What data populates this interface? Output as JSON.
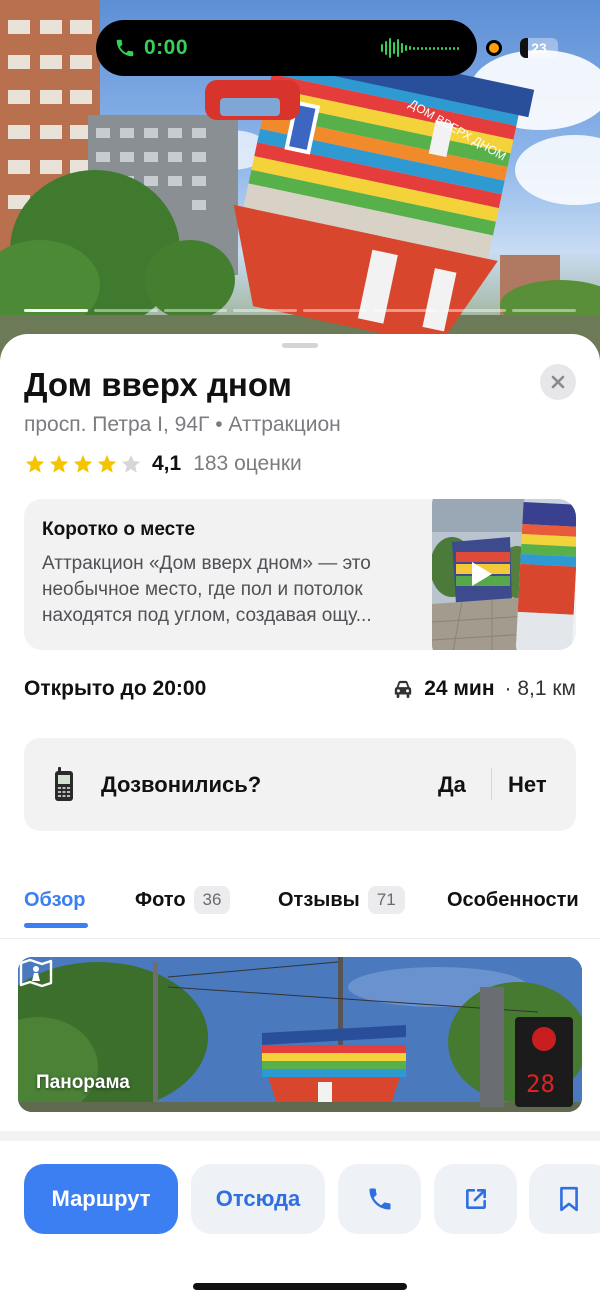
{
  "status": {
    "call_timer": "0:00",
    "battery": "23"
  },
  "place": {
    "title": "Дом вверх дном",
    "subtitle": "просп. Петра I, 94Г • Аттракцион",
    "rating_value": "4,1",
    "rating_stars": 4,
    "reviews_count_text": "183 оценки"
  },
  "about": {
    "heading": "Коротко о месте",
    "text": "Аттракцион «Дом вверх дном» — это необычное место, где пол и потолок находятся под углом, создавая ощу..."
  },
  "hours": {
    "open_text": "Открыто до 20:00",
    "travel_time": "24 мин",
    "distance": "· 8,1 км"
  },
  "call_prompt": {
    "question": "Дозвонились?",
    "yes": "Да",
    "no": "Нет"
  },
  "tabs": [
    {
      "label": "Обзор",
      "count": ""
    },
    {
      "label": "Фото",
      "count": "36"
    },
    {
      "label": "Отзывы",
      "count": "71"
    },
    {
      "label": "Особенности",
      "count": ""
    }
  ],
  "panorama": {
    "label": "Панорама"
  },
  "actions": {
    "route": "Маршрут",
    "from_here": "Отсюда"
  },
  "colors": {
    "accent": "#3b7ff2",
    "call_green": "#36d058",
    "star": "#f5c400"
  }
}
